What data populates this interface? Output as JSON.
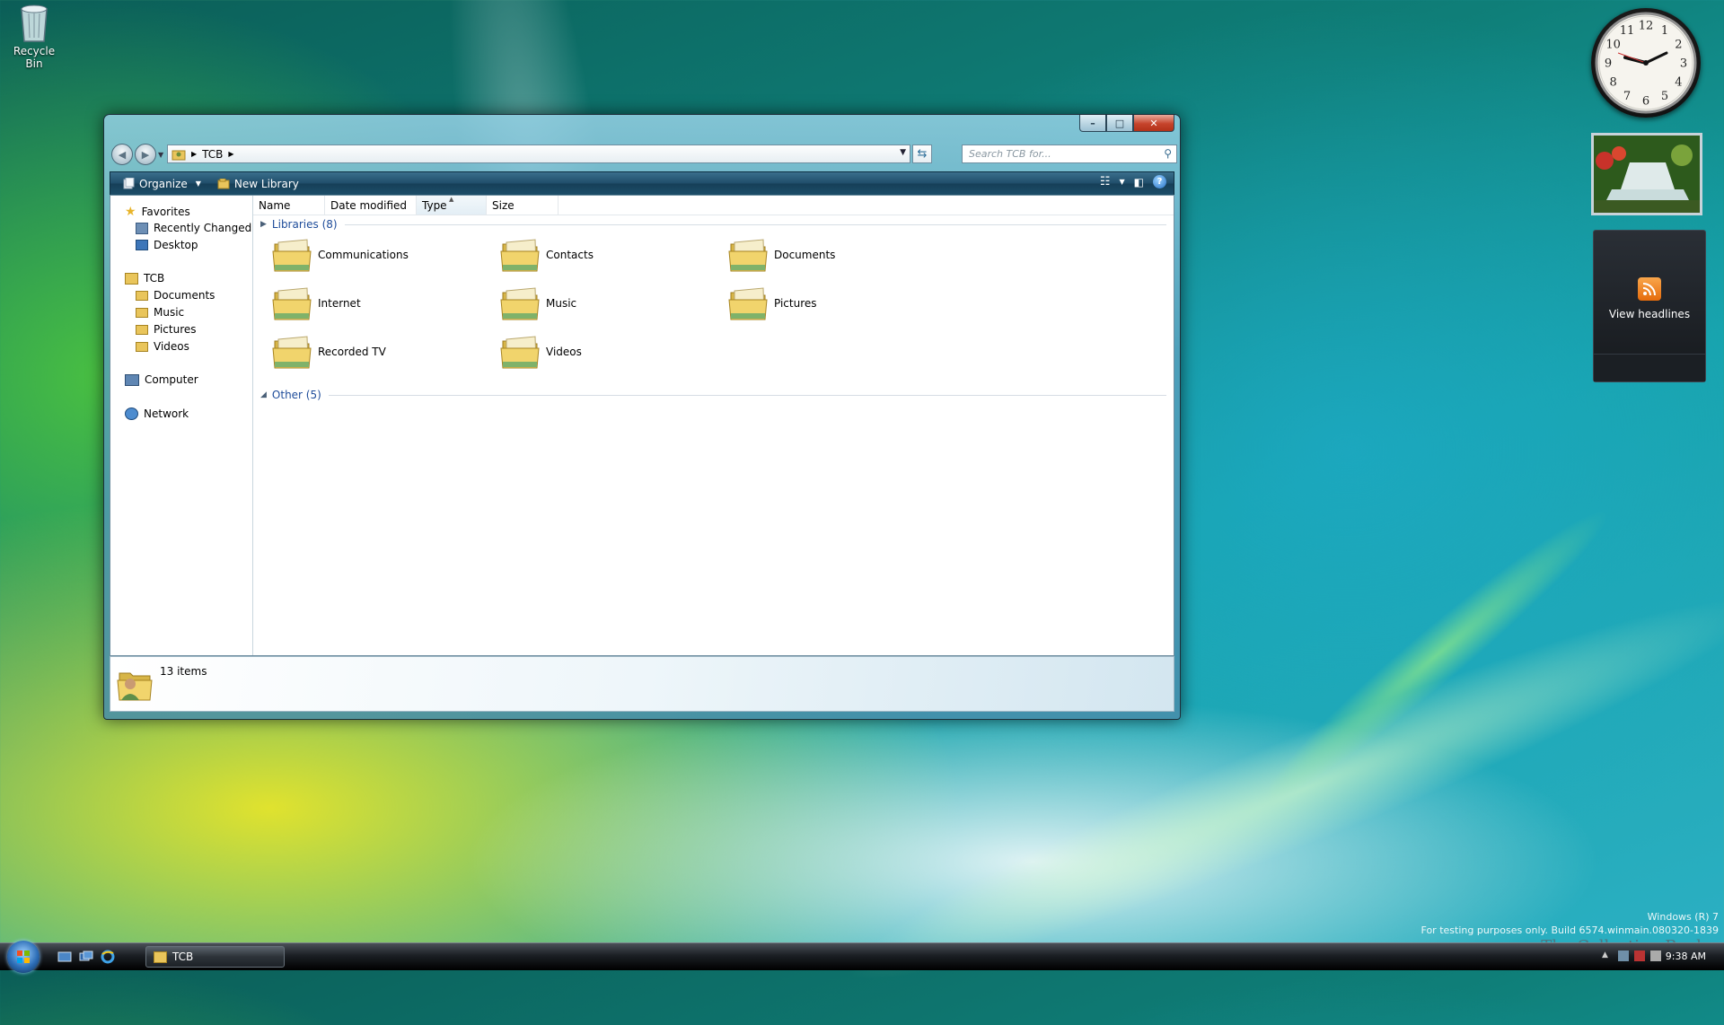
{
  "desktop": {
    "recycle_bin_label": "Recycle Bin"
  },
  "window": {
    "title": "TCB",
    "caption": {
      "minimize": "–",
      "maximize": "□",
      "close": "✕"
    },
    "address": {
      "crumb": "TCB"
    },
    "search": {
      "placeholder": "Search TCB for..."
    },
    "toolbar": {
      "organize": "Organize",
      "new_library": "New Library"
    },
    "nav_pane": {
      "favorites_header": "Favorites",
      "favorites": [
        "Recently Changed",
        "Desktop"
      ],
      "user_header": "TCB",
      "user_items": [
        "Documents",
        "Music",
        "Pictures",
        "Videos"
      ],
      "computer": "Computer",
      "network": "Network"
    },
    "columns": [
      "Name",
      "Date modified",
      "Type",
      "Size"
    ],
    "groups": [
      {
        "label": "Libraries (8)",
        "expanded": false
      },
      {
        "label": "Other (5)",
        "expanded": true
      }
    ],
    "libraries": [
      "Communications",
      "Contacts",
      "Documents",
      "Internet",
      "Music",
      "Pictures",
      "Recorded TV",
      "Videos"
    ],
    "status": {
      "item_count": "13 items"
    }
  },
  "gadgets": {
    "feed_label": "View headlines",
    "clock_numerals": [
      "12",
      "1",
      "2",
      "3",
      "4",
      "5",
      "6",
      "7",
      "8",
      "9",
      "10",
      "11"
    ]
  },
  "watermark": {
    "line1": "Windows (R) 7",
    "line2": "For testing purposes only. Build 6574.winmain.080320-1839",
    "brand": "The Collection Book"
  },
  "taskbar": {
    "task_label": "TCB",
    "time": "9:38 AM"
  },
  "colors": {
    "accent": "#1e4c9a",
    "commandbar": "#1f4d69",
    "close_button": "#c6442c"
  }
}
